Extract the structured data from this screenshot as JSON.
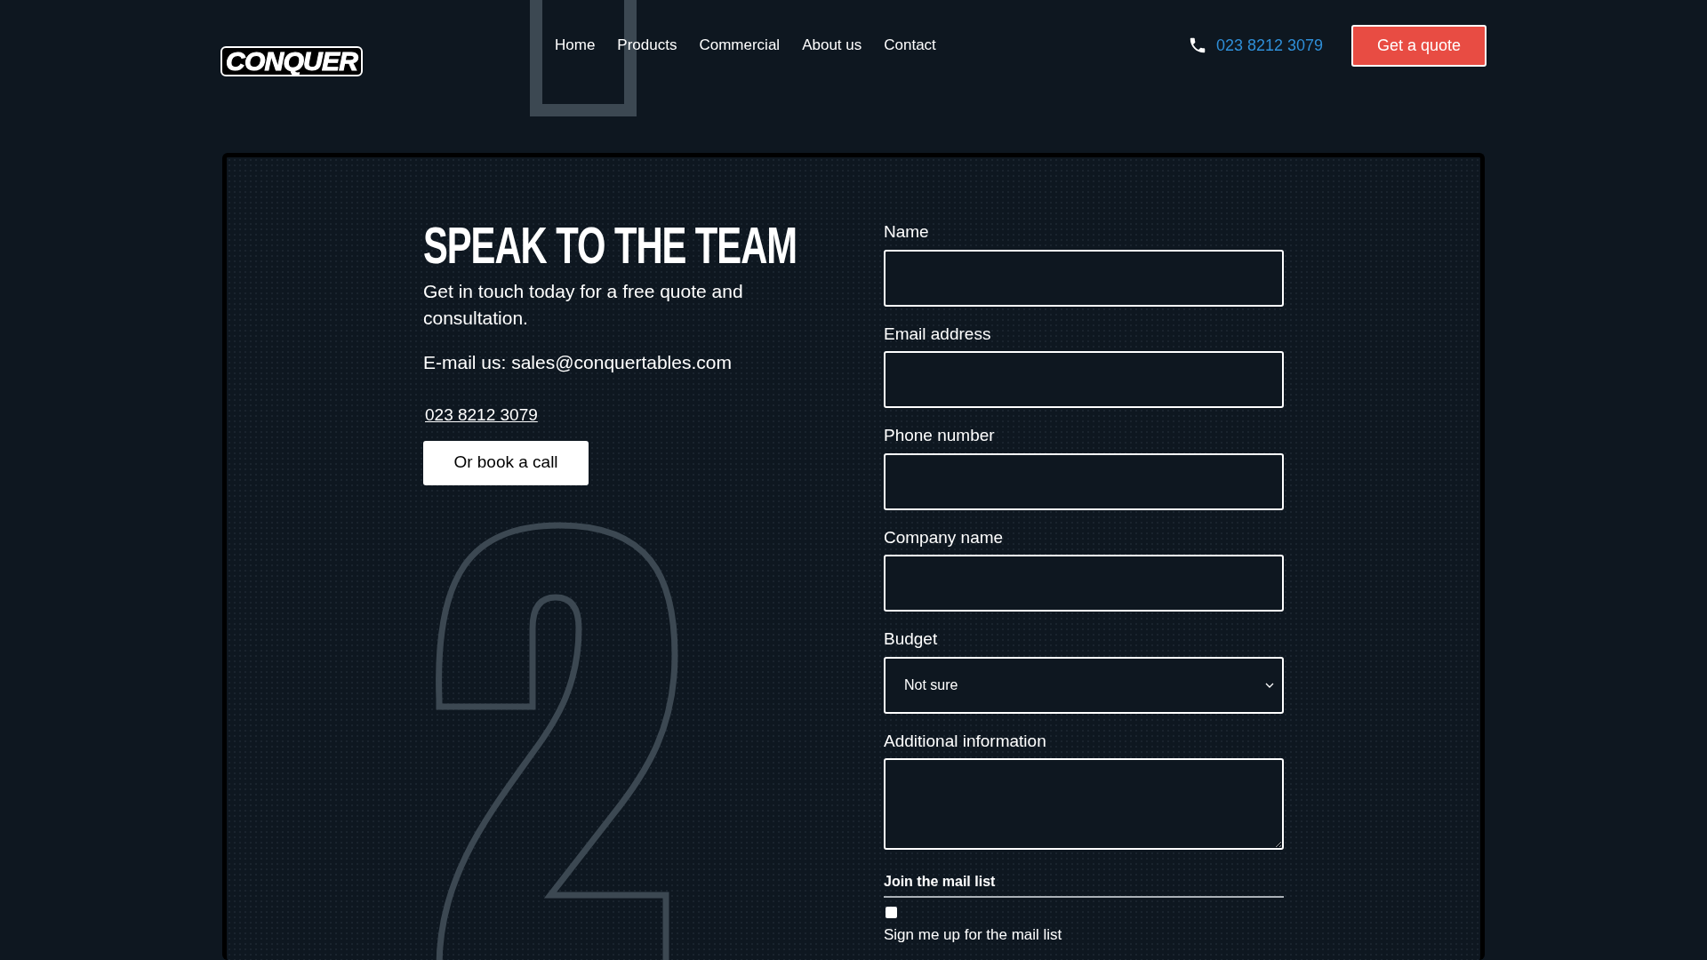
{
  "header": {
    "logo": "CONQUER",
    "nav": [
      {
        "label": "Home"
      },
      {
        "label": "Products"
      },
      {
        "label": "Commercial"
      },
      {
        "label": "About us"
      },
      {
        "label": "Contact"
      }
    ],
    "phone": "023 8212 3079",
    "cta": "Get a quote"
  },
  "contact": {
    "heading": "SPEAK TO THE TEAM",
    "intro": "Get in touch today for a free quote and consultation.",
    "email": "E-mail us: sales@conquertables.com",
    "phone": "023 8212 3079",
    "book_button": "Or book a call"
  },
  "form": {
    "fields": [
      {
        "kind": "text",
        "label": "Name"
      },
      {
        "kind": "text",
        "label": "Email address"
      },
      {
        "kind": "text",
        "label": "Phone number"
      },
      {
        "kind": "text",
        "label": "Company name"
      },
      {
        "kind": "select",
        "label": "Budget",
        "value": "Not sure"
      },
      {
        "kind": "textarea",
        "label": "Additional information"
      }
    ],
    "mail_list": {
      "heading": "Join the mail list",
      "checked": false,
      "label": "Sign me up for the mail list"
    }
  }
}
